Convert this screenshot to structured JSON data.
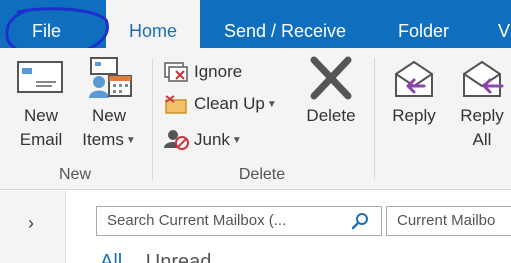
{
  "tabs": {
    "file": "File",
    "home": "Home",
    "send_receive": "Send / Receive",
    "folder": "Folder",
    "view_partial": "V"
  },
  "ribbon": {
    "new_group": {
      "label": "New",
      "new_email": [
        "New",
        "Email"
      ],
      "new_items": [
        "New",
        "Items"
      ]
    },
    "delete_group": {
      "label": "Delete",
      "ignore": "Ignore",
      "clean_up": "Clean Up",
      "junk": "Junk",
      "delete": "Delete"
    },
    "respond_group": {
      "reply": "Reply",
      "reply_all": [
        "Reply",
        "All"
      ]
    }
  },
  "search": {
    "placeholder": "Search Current Mailbox (...",
    "scope": "Current Mailbo"
  },
  "filters": {
    "all": "All",
    "unread": "Unread"
  },
  "icons": {
    "search": "search-icon",
    "chevron": "chevron-right-icon"
  },
  "colors": {
    "tabbar": "#106ebe",
    "ribbon": "#f4f4f4",
    "annotation": "#1e2fd0"
  }
}
